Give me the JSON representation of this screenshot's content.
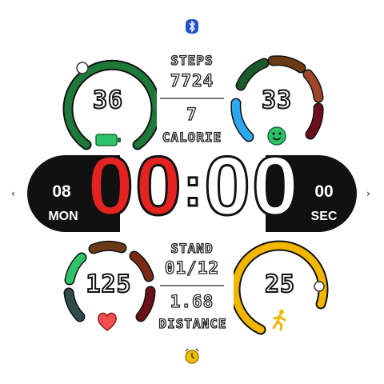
{
  "top_center": {
    "steps_label": "STEPS",
    "steps_value": "7724",
    "calorie_value": "7",
    "calorie_label": "CALORIE"
  },
  "bottom_center": {
    "stand_label": "STAND",
    "stand_value": "01/12",
    "distance_value": "1.68",
    "distance_label": "DISTANCE"
  },
  "top_left": {
    "value": "36",
    "icon": "battery-icon",
    "color": "#1e7a3a"
  },
  "top_right": {
    "value": "33",
    "icon": "smiley-icon"
  },
  "bottom_left": {
    "value": "125",
    "icon": "heart-icon"
  },
  "bottom_right": {
    "value": "25",
    "icon": "running-icon",
    "color": "#f2b600"
  },
  "time": {
    "hours": "00",
    "separator": ":",
    "minutes": "00"
  },
  "left_pill": {
    "day": "08",
    "weekday": "MON"
  },
  "right_pill": {
    "seconds": "00",
    "seconds_label": "SEC"
  },
  "status": {
    "top_icon": "bluetooth-icon",
    "bottom_icon": "alarm-icon"
  },
  "colors": {
    "hours": "#e52222",
    "minutes": "#ffffff",
    "pill": "#111111",
    "bluetooth": "#1f4fc9",
    "alarm": "#f2c100"
  }
}
